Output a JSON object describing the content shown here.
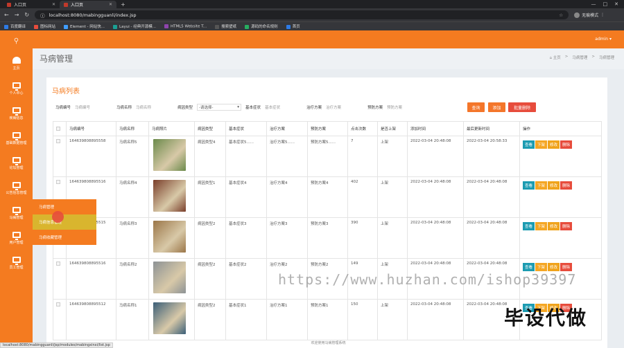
{
  "browser": {
    "tabs": [
      {
        "label": "入口页"
      },
      {
        "label": "入口页"
      }
    ],
    "url": "localhost:8080/mabingguanli/index.jsp",
    "profile": "无痕模式",
    "bookmarks": [
      "百度翻译",
      "图标网站",
      "Element - 网站快...",
      "Layui - 经典开源模...",
      "HTML5 Website T...",
      "搜索壁纸",
      "源码的命名规则",
      "首页"
    ]
  },
  "sidebar": {
    "items": [
      {
        "label": "主页",
        "icon": "dashboard-icon"
      },
      {
        "label": "个人中心",
        "icon": "monitor-icon"
      },
      {
        "label": "疾病信息",
        "icon": "monitor-icon"
      },
      {
        "label": "基础数据管理",
        "icon": "monitor-icon"
      },
      {
        "label": "论坛管理",
        "icon": "monitor-icon"
      },
      {
        "label": "公告信息管理",
        "icon": "monitor-icon"
      },
      {
        "label": "马病管理",
        "icon": "monitor-icon"
      },
      {
        "label": "用户管理",
        "icon": "monitor-icon"
      },
      {
        "label": "员工管理",
        "icon": "monitor-icon"
      }
    ],
    "flyout": [
      "马病管理",
      "马病信息管理",
      "马病收藏管理"
    ]
  },
  "header": {
    "user": "admin ▾"
  },
  "page": {
    "title": "马病管理",
    "breadcrumb": [
      "⌂ 主页",
      ">",
      "马病管理",
      ">",
      "马病管理"
    ]
  },
  "list": {
    "title": "马病列表",
    "search": {
      "code_label": "马病编号",
      "code_placeholder": "马病编号",
      "name_label": "马病名称",
      "name_placeholder": "马病名称",
      "type_label": "病因类型",
      "type_value": "-请选择-",
      "symptom_label": "基本症状",
      "symptom_placeholder": "基本症状",
      "treat_label": "治疗方案",
      "treat_placeholder": "治疗方案",
      "prevent_label": "预防方案",
      "prevent_placeholder": "预防方案"
    },
    "buttons": {
      "query": "查询",
      "add": "添加",
      "batch_delete": "批量删除"
    },
    "columns": [
      "",
      "马病编号",
      "马病名称",
      "马病照片",
      "病因类型",
      "基本症状",
      "治疗方案",
      "预防方案",
      "点击次数",
      "是否上架",
      "添加时间",
      "最后更新时间",
      "操作"
    ],
    "ops": [
      "查看",
      "下架",
      "修改",
      "删除"
    ],
    "rows": [
      {
        "code": "164639808895558",
        "name": "马病名称5",
        "type": "病因类型4",
        "symptom": "基本症状5......",
        "treat": "治疗方案5......",
        "prevent": "预防方案5......",
        "clicks": "7",
        "shelf": "上架",
        "added": "2022-03-04 20:48:08",
        "updated": "2022-03-04 20:58:33",
        "img": "#6b8a4b"
      },
      {
        "code": "164639808895516",
        "name": "马病名称4",
        "type": "病因类型1",
        "symptom": "基本症状4",
        "treat": "治疗方案4",
        "prevent": "预防方案4",
        "clicks": "402",
        "shelf": "上架",
        "added": "2022-03-04 20:48:08",
        "updated": "2022-03-04 20:48:08",
        "img": "#7a3e2a"
      },
      {
        "code": "164639808895515",
        "name": "马病名称3",
        "type": "病因类型2",
        "symptom": "基本症状3",
        "treat": "治疗方案3",
        "prevent": "预防方案3",
        "clicks": "390",
        "shelf": "上架",
        "added": "2022-03-04 20:48:08",
        "updated": "2022-03-04 20:48:08",
        "img": "#9b7648"
      },
      {
        "code": "164639808895516",
        "name": "马病名称2",
        "type": "病因类型2",
        "symptom": "基本症状2",
        "treat": "治疗方案2",
        "prevent": "预防方案2",
        "clicks": "149",
        "shelf": "上架",
        "added": "2022-03-04 20:48:08",
        "updated": "2022-03-04 20:48:08",
        "img": "#8d9295"
      },
      {
        "code": "164639808895512",
        "name": "马病名称1",
        "type": "病因类型2",
        "symptom": "基本症状1",
        "treat": "治疗方案1",
        "prevent": "预防方案1",
        "clicks": "150",
        "shelf": "上架",
        "added": "2022-03-04 20:48:08",
        "updated": "2022-03-04 20:48:08",
        "img": "#3b5f78"
      }
    ]
  },
  "footer": "欢迎使用马病管理系统",
  "status_url": "localhost:8080/mabingguanli/jsp/modules/mabingxinxi/list.jsp",
  "watermark": {
    "url": "https://www.huzhan.com/ishop39397",
    "text": "毕设代做"
  },
  "colors": {
    "accent": "#f47b20",
    "view": "#1b9bb1",
    "down": "#f0a31b",
    "delete": "#e74c3c"
  }
}
